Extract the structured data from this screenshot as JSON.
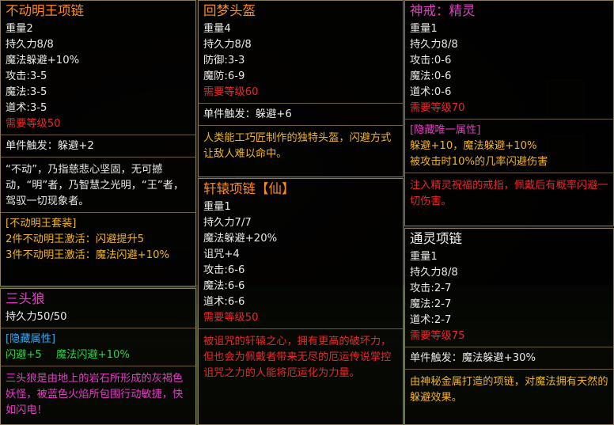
{
  "tooltips": {
    "necklace": {
      "title": "不动明王项链",
      "weight": "重量2",
      "durability": "持久力8/8",
      "magic_evasion": "魔法躲避+10%",
      "attack": "攻击:3-5",
      "magic": "魔法:3-5",
      "taoism": "道术:3-5",
      "req_level": "需要等级50",
      "trigger": "单件触发：躲避+2",
      "lore": "“不动”，乃指慈悲心坚固，无可撼动，“明”者，乃智慧之光明，“王”者，驾驭一切现象者。",
      "set_header": "[不动明王套装]",
      "set_2": "2件不动明王激活：闪避提升5",
      "set_3": "3件不动明王激活：魔法闪避+10%"
    },
    "helmet": {
      "title": "回梦头盔",
      "weight": "重量4",
      "durability": "持久力8/8",
      "defense": "防御:3-3",
      "mdefense": "魔防:6-9",
      "req_level": "需要等级60",
      "trigger": "单件触发：躲避+6",
      "lore": "人类能工巧匠制作的独特头盔，闪避方式让敌人难以命中。"
    },
    "ring": {
      "title": "神戒：精灵",
      "weight": "重量1",
      "durability": "持久力8/8",
      "attack": "攻击:0-6",
      "magic": "魔法:0-6",
      "taoism": "道术:0-6",
      "req_level": "需要等级70",
      "hidden_header": "[隐藏唯一属性]",
      "hidden_1": "躲避+10，魔法躲避+10%",
      "hidden_2": "被攻击时10%的几率闪避伤害",
      "lore": "注入精灵祝福的戒指，佩戴后有概率闪避一切伤害。"
    },
    "xuanyuan": {
      "title": "轩辕项链【仙】",
      "weight": "重量1",
      "durability": "持久力7/7",
      "magic_evasion": "魔法躲避+20%",
      "curse": "诅咒+4",
      "attack": "攻击:6-6",
      "magic": "魔法:6-6",
      "taoism": "道术:6-6",
      "req_level": "需要等级50",
      "lore": "被诅咒的轩辕之心，拥有更高的破坏力，但也会为佩戴者带来无尽的厄运传说掌控诅咒之力的人能将厄运化为力量。"
    },
    "wolf": {
      "title": "三头狼",
      "durability": "持久力50/50",
      "hidden_header": "[隐藏属性]",
      "hidden_1": "闪避+5",
      "hidden_2": "魔法闪避+10%",
      "lore": "三头狼是由地上的岩石所形成的灰褐色妖怪，被蓝色火焰所包围行动敏捷，快如闪电！"
    },
    "tongling": {
      "title": "通灵项链",
      "weight": "重量1",
      "durability": "持久力8/8",
      "attack": "攻击:2-7",
      "magic": "魔法:2-7",
      "taoism": "道术:2-7",
      "req_level": "需要等级75",
      "trigger": "单件触发：魔法躲避+30%",
      "lore": "由神秘金属打造的项链，对魔法拥有天然的躲避效果。"
    }
  }
}
